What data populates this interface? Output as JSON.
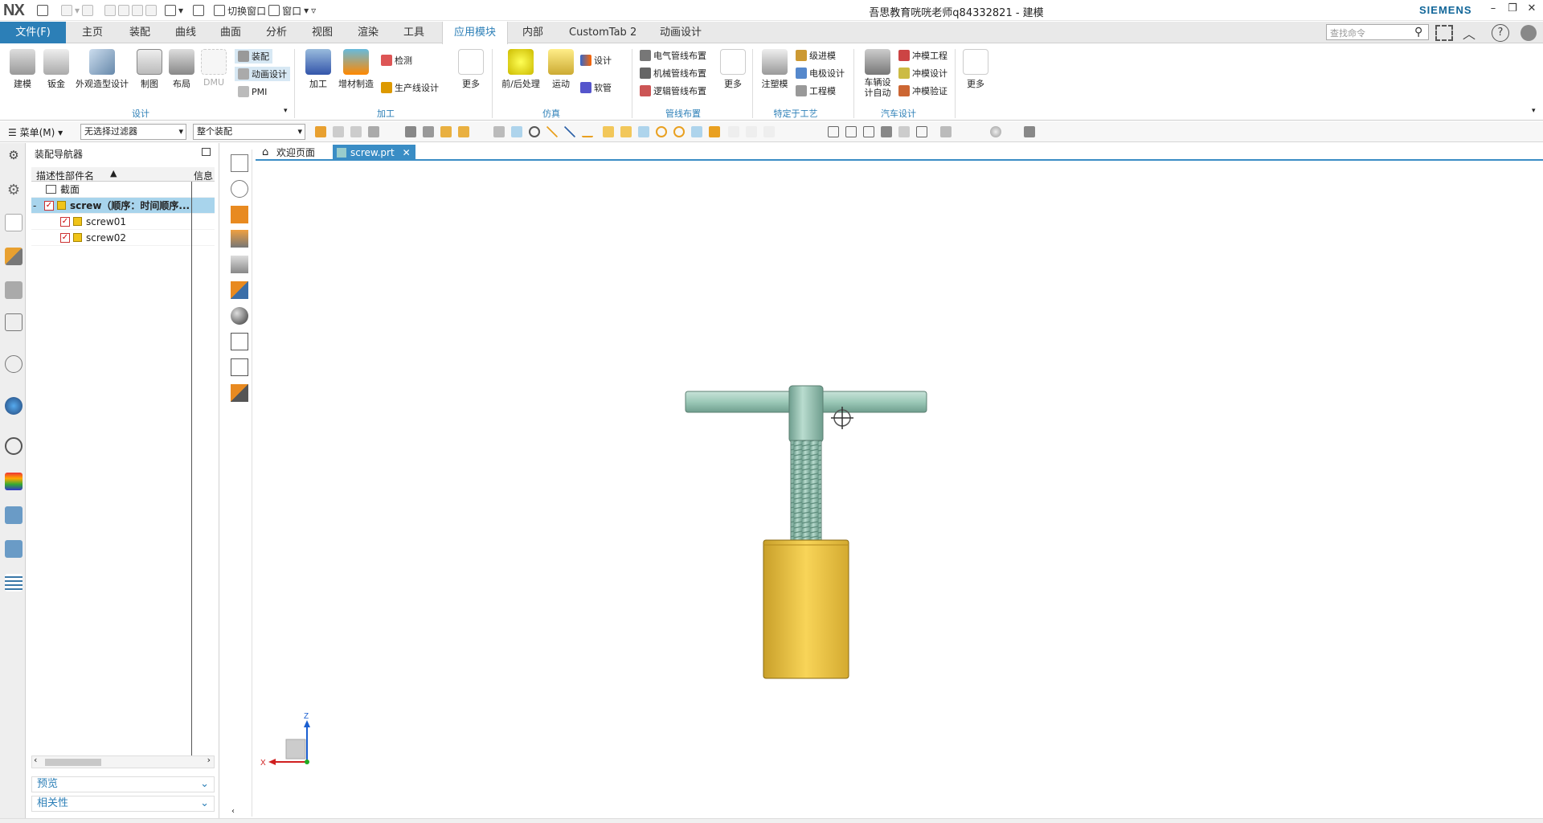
{
  "app": {
    "logo": "NX",
    "window_title": "吾思教育咣咣老师q84332821 - 建模",
    "brand": "SIEMENS"
  },
  "quick_access": {
    "switch_window": "切换窗口",
    "window": "窗口"
  },
  "menu_tabs": [
    "文件(F)",
    "主页",
    "装配",
    "曲线",
    "曲面",
    "分析",
    "视图",
    "渲染",
    "工具",
    "应用模块",
    "内部",
    "CustomTab 2",
    "动画设计"
  ],
  "active_tab": "应用模块",
  "search": {
    "placeholder": "查找命令"
  },
  "ribbon": {
    "design": {
      "group_label": "设计",
      "big": [
        "建模",
        "钣金",
        "外观造型设计",
        "制图",
        "布局",
        "DMU"
      ],
      "small": [
        "装配",
        "动画设计",
        "PMI"
      ]
    },
    "machining": {
      "group_label": "加工",
      "big": [
        "加工",
        "增材制造"
      ],
      "small": [
        "检测",
        "生产线设计"
      ],
      "more": "更多"
    },
    "simulation": {
      "group_label": "仿真",
      "big": [
        "前/后处理",
        "运动"
      ],
      "small": [
        "设计",
        "软管"
      ]
    },
    "routing": {
      "group_label": "管线布置",
      "small": [
        "电气管线布置",
        "机械管线布置",
        "逻辑管线布置"
      ],
      "more": "更多"
    },
    "process": {
      "group_label": "特定于工艺",
      "big": [
        "注塑模"
      ],
      "small": [
        "级进模",
        "电极设计",
        "工程模"
      ]
    },
    "auto": {
      "group_label": "汽车设计",
      "big": [
        "车辆设计自动"
      ],
      "small": [
        "冲模工程",
        "冲模设计",
        "冲模验证"
      ],
      "more": "更多"
    }
  },
  "toolbar2": {
    "menu": "菜单(M)",
    "filter": "无选择过滤器",
    "scope": "整个装配"
  },
  "navigator": {
    "title": "装配导航器",
    "col_name": "描述性部件名",
    "col_info": "信息",
    "rows": [
      {
        "label": "截面",
        "type": "folder"
      },
      {
        "label": "screw（顺序：时间顺序...",
        "type": "assembly"
      },
      {
        "label": "screw01",
        "type": "part"
      },
      {
        "label": "screw02",
        "type": "part"
      }
    ],
    "preview": "预览",
    "dependencies": "相关性"
  },
  "doc_tabs": [
    "欢迎页面",
    "screw.prt"
  ],
  "triad": {
    "x": "X",
    "z": "Z"
  },
  "colors": {
    "accent": "#2c7fb7",
    "handle": "#9cc9b8",
    "nut": "#f0c640",
    "selection": "#a8d4ec"
  }
}
